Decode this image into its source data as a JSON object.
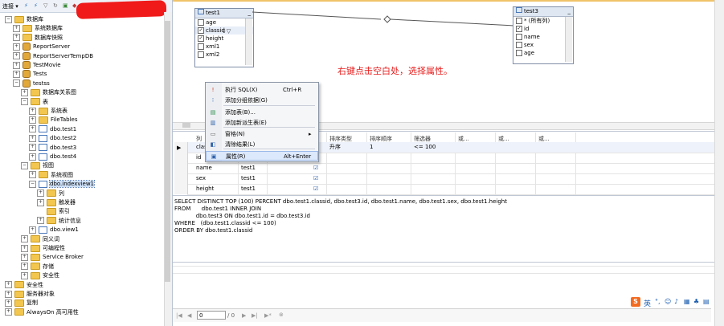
{
  "explorer": {
    "toolbar_label": "连接 ▾",
    "tree": [
      {
        "label": "数据库",
        "indent": 1,
        "exp": "⊟",
        "icon": "fld",
        "name": "tree-item-databases"
      },
      {
        "label": "系统数据库",
        "indent": 2,
        "exp": "⊞",
        "icon": "fld",
        "name": "tree-item-system-databases"
      },
      {
        "label": "数据库快照",
        "indent": 2,
        "exp": "⊞",
        "icon": "fld",
        "name": "tree-item-database-snapshots"
      },
      {
        "label": "ReportServer",
        "indent": 2,
        "exp": "⊞",
        "icon": "db",
        "name": "tree-item-reportserver"
      },
      {
        "label": "ReportServerTempDB",
        "indent": 2,
        "exp": "⊞",
        "icon": "db",
        "name": "tree-item-reportservertempdb"
      },
      {
        "label": "TestMovie",
        "indent": 2,
        "exp": "⊞",
        "icon": "db",
        "name": "tree-item-testmovie"
      },
      {
        "label": "Tests",
        "indent": 2,
        "exp": "⊞",
        "icon": "db",
        "name": "tree-item-tests"
      },
      {
        "label": "testss",
        "indent": 2,
        "exp": "⊟",
        "icon": "db",
        "name": "tree-item-testss"
      },
      {
        "label": "数据库关系图",
        "indent": 3,
        "exp": "⊞",
        "icon": "fld",
        "name": "tree-item-database-diagrams"
      },
      {
        "label": "表",
        "indent": 3,
        "exp": "⊟",
        "icon": "fld",
        "name": "tree-item-tables"
      },
      {
        "label": "系统表",
        "indent": 4,
        "exp": "⊞",
        "icon": "fld",
        "name": "tree-item-system-tables"
      },
      {
        "label": "FileTables",
        "indent": 4,
        "exp": "⊞",
        "icon": "fld",
        "name": "tree-item-filetables"
      },
      {
        "label": "dbo.test1",
        "indent": 4,
        "exp": "⊞",
        "icon": "tbl",
        "name": "tree-item-dbo-test1"
      },
      {
        "label": "dbo.test2",
        "indent": 4,
        "exp": "⊞",
        "icon": "tbl",
        "name": "tree-item-dbo-test2"
      },
      {
        "label": "dbo.test3",
        "indent": 4,
        "exp": "⊞",
        "icon": "tbl",
        "name": "tree-item-dbo-test3"
      },
      {
        "label": "dbo.test4",
        "indent": 4,
        "exp": "⊞",
        "icon": "tbl",
        "name": "tree-item-dbo-test4"
      },
      {
        "label": "视图",
        "indent": 3,
        "exp": "⊟",
        "icon": "fld",
        "name": "tree-item-views"
      },
      {
        "label": "系统视图",
        "indent": 4,
        "exp": "⊞",
        "icon": "fld",
        "name": "tree-item-system-views"
      },
      {
        "label": "dbo.indexview1",
        "indent": 4,
        "exp": "⊟",
        "icon": "tbl",
        "name": "tree-item-dbo-indexview1"
      },
      {
        "label": "列",
        "indent": 5,
        "exp": "⊞",
        "icon": "fld",
        "name": "tree-item-columns"
      },
      {
        "label": "触发器",
        "indent": 5,
        "exp": "⊞",
        "icon": "fld",
        "name": "tree-item-triggers"
      },
      {
        "label": "索引",
        "indent": 5,
        "exp": "",
        "icon": "fld",
        "name": "tree-item-indexes"
      },
      {
        "label": "统计信息",
        "indent": 5,
        "exp": "⊞",
        "icon": "fld",
        "name": "tree-item-statistics"
      },
      {
        "label": "dbo.view1",
        "indent": 4,
        "exp": "⊞",
        "icon": "tbl",
        "name": "tree-item-dbo-view1"
      },
      {
        "label": "同义词",
        "indent": 3,
        "exp": "⊞",
        "icon": "fld",
        "name": "tree-item-synonyms"
      },
      {
        "label": "可编程性",
        "indent": 3,
        "exp": "⊞",
        "icon": "fld",
        "name": "tree-item-programmability"
      },
      {
        "label": "Service Broker",
        "indent": 3,
        "exp": "⊞",
        "icon": "fld",
        "name": "tree-item-service-broker"
      },
      {
        "label": "存储",
        "indent": 3,
        "exp": "⊞",
        "icon": "fld",
        "name": "tree-item-storage"
      },
      {
        "label": "安全性",
        "indent": 3,
        "exp": "⊞",
        "icon": "fld",
        "name": "tree-item-db-security"
      },
      {
        "label": "安全性",
        "indent": 1,
        "exp": "⊞",
        "icon": "fld",
        "name": "tree-item-security"
      },
      {
        "label": "服务器对象",
        "indent": 1,
        "exp": "⊞",
        "icon": "fld",
        "name": "tree-item-server-objects"
      },
      {
        "label": "复制",
        "indent": 1,
        "exp": "⊞",
        "icon": "fld",
        "name": "tree-item-replication"
      },
      {
        "label": "AlwaysOn 高可用性",
        "indent": 1,
        "exp": "⊞",
        "icon": "fld",
        "name": "tree-item-alwayson"
      }
    ]
  },
  "diagram": {
    "table1": {
      "title": "test1",
      "cols": [
        {
          "label": "age",
          "checked": false
        },
        {
          "label": "classid",
          "checked": true
        },
        {
          "label": "height",
          "checked": true
        },
        {
          "label": "xml1",
          "checked": false
        },
        {
          "label": "xml2",
          "checked": false
        }
      ]
    },
    "table3": {
      "title": "test3",
      "cols": [
        {
          "label": "* (所有列)",
          "checked": false
        },
        {
          "label": "id",
          "checked": true
        },
        {
          "label": "name",
          "checked": false
        },
        {
          "label": "sex",
          "checked": false
        },
        {
          "label": "age",
          "checked": false
        }
      ]
    },
    "annotation": "右键点击空白处，选择属性。"
  },
  "context_menu": {
    "items": [
      {
        "label": "执行 SQL(X)",
        "shortcut": "Ctrl+R",
        "icon": "execute-icon"
      },
      {
        "label": "添加分组依据(G)",
        "shortcut": "",
        "icon": "group-by-icon"
      },
      {
        "label": "添加表(B)...",
        "shortcut": "",
        "icon": "add-table-icon"
      },
      {
        "label": "添加新派生表(E)",
        "shortcut": "",
        "icon": "add-derived-table-icon"
      },
      {
        "label": "窗格(N)",
        "shortcut": "▸",
        "icon": "pane-icon"
      },
      {
        "label": "清除结果(L)",
        "shortcut": "",
        "icon": "clear-results-icon"
      },
      {
        "label": "属性(R)",
        "shortcut": "Alt+Enter",
        "icon": "properties-icon"
      }
    ]
  },
  "grid": {
    "headers": [
      "列",
      "",
      "",
      "排序类型",
      "排序顺序",
      "筛选器",
      "或...",
      "或...",
      "或..."
    ],
    "rows": [
      {
        "col": "clas",
        "table": "",
        "output": "",
        "sort_type": "升序",
        "sort_order": "1",
        "filter": "<= 100"
      },
      {
        "col": "id",
        "table": "",
        "output": "",
        "sort_type": "",
        "sort_order": "",
        "filter": ""
      },
      {
        "col": "name",
        "table": "test1",
        "output": "☑",
        "sort_type": "",
        "sort_order": "",
        "filter": ""
      },
      {
        "col": "sex",
        "table": "test1",
        "output": "☑",
        "sort_type": "",
        "sort_order": "",
        "filter": ""
      },
      {
        "col": "height",
        "table": "test1",
        "output": "☑",
        "sort_type": "",
        "sort_order": "",
        "filter": ""
      }
    ]
  },
  "sql": [
    "SELECT DISTINCT TOP (100) PERCENT dbo.test1.classid, dbo.test3.id, dbo.test1.name, dbo.test1.sex, dbo.test1.height",
    "FROM      dbo.test1 INNER JOIN",
    "            dbo.test3 ON dbo.test1.id = dbo.test3.id",
    "WHERE   (dbo.test1.classid <= 100)",
    "ORDER BY dbo.test1.classid"
  ],
  "nav": {
    "page_value": "0",
    "of_text": "/ 0",
    "first": "|◀",
    "prev": "◀",
    "next": "▶",
    "last": "▶|",
    "new": "▶*"
  }
}
